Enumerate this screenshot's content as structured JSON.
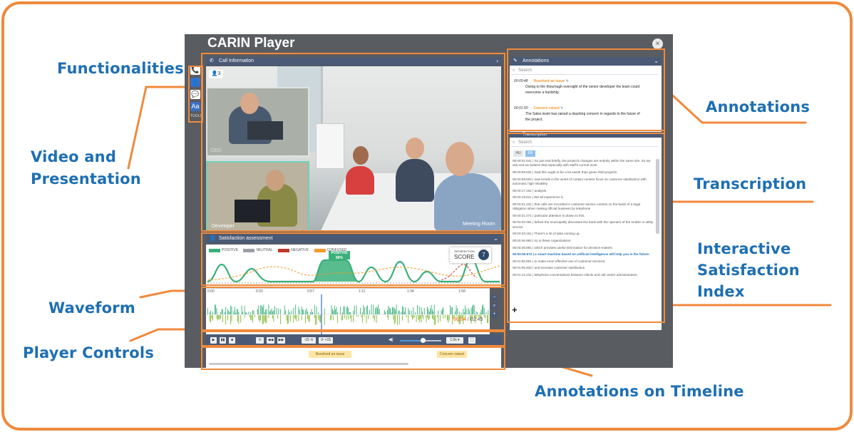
{
  "callouts": {
    "functionalities": "Functionalities",
    "video_line1": "Video and",
    "video_line2": "Presentation",
    "waveform": "Waveform",
    "player_controls": "Player Controls",
    "annotations": "Annotations",
    "transcription": "Transcription",
    "isi_line1": "Interactive",
    "isi_line2": "Satisfaction",
    "isi_line3": "Index",
    "annotations_timeline": "Annotations on Timeline"
  },
  "app": {
    "title": "CARIN Player",
    "close_glyph": "×",
    "tools": [
      "📞",
      "👤",
      "💬",
      "Aa"
    ],
    "tools_label": "TOOLS"
  },
  "call_info": {
    "header": "Call Information",
    "participant_count": "3",
    "label_developer": "Developer",
    "label_meeting_room": "Meeting Room",
    "pip_label": "CEO"
  },
  "satisfaction": {
    "header": "Satisfaction assessment",
    "legend": [
      {
        "label": "POSITIVE",
        "color": "#3bb07b"
      },
      {
        "label": "NEUTRAL",
        "color": "#9aa0a6"
      },
      {
        "label": "NEGATIVE",
        "color": "#c0392b"
      },
      {
        "label": "CONFUSED",
        "color": "#f29a2e"
      }
    ],
    "score_label": "SATISFACTION",
    "score_word": "SCORE",
    "score_value": "7",
    "tooltip_label": "POSITIVE",
    "tooltip_value": "86%"
  },
  "timeline": {
    "ticks": [
      "0:00",
      "0:20",
      "0:57",
      "1:11",
      "1:34",
      "1:58"
    ],
    "current": "00:54",
    "total": "02:45",
    "zoom_buttons": [
      "−",
      "⌕",
      "+"
    ]
  },
  "controls": {
    "play": "▶",
    "pause": "▮▮",
    "stop": "■",
    "loop": "⟲",
    "back": "◀◀",
    "fwd": "▶▶",
    "skip_back": "-15 ⟲",
    "skip_fwd": "⟳ +15",
    "volume_icon": "◀)",
    "volume_level": 0.55,
    "speed": "1.0x ▾",
    "fullscreen": "⛶"
  },
  "timeline_annotations": {
    "items": [
      "Resolved an issue",
      "Concern raised"
    ]
  },
  "annotations_panel": {
    "header": "Annotations",
    "search_placeholder": "Search",
    "items": [
      {
        "time": "00:00:48",
        "title": "Resolved an issue",
        "text": "Owing to the thourough oversight of the senior developer the team could overcome a hardship."
      },
      {
        "time": "00:01:50",
        "title": "Concern raised",
        "text": "The Sales team has raised a daunting concern in regards to the future of the project."
      }
    ]
  },
  "transcription_panel": {
    "header": "Transcription",
    "search_placeholder": "Search",
    "languages": [
      "HU",
      "EN"
    ],
    "add_glyph": "+",
    "lines": [
      "00:00:01.641 | So just real briefly, the project's changes are entirely within the same site. So we ask and we believe that especially with staff's current work",
      "00:00:08.501 | load this ought to be a lot easier than green field projects.",
      "00:00:08.602 | new trends in the world of contact centers focus on customer satisfaction with automatic high reliability",
      "00:00:17.181 | analysis.",
      "00:00:19.611 | We all experience it.",
      "00:00:21.231 | that calls are recorded in customer service centres on the basis of a legal obligation when making official business by telephone",
      "00:00:31.071 | particular attention is drawn to this.",
      "00:00:33.381 | before the municipality discusses the bank with the operator of the mobile or utility service",
      "00:00:43.161 | There's a lot of data coming up,",
      "00:00:46.962 | so in these organizations.",
      "00:00:48.881 | which provides useful information for decision-makers",
      "00:00:50.972 | a smart machine based on artificial intelligence will help you in the future.",
      "00:01:00.801 | to make more effective use of customer services;",
      "00:01:05.932 | and increase customer satisfaction",
      "00:01:12.231 | telephone conversations between clients and call center administrators."
    ]
  }
}
